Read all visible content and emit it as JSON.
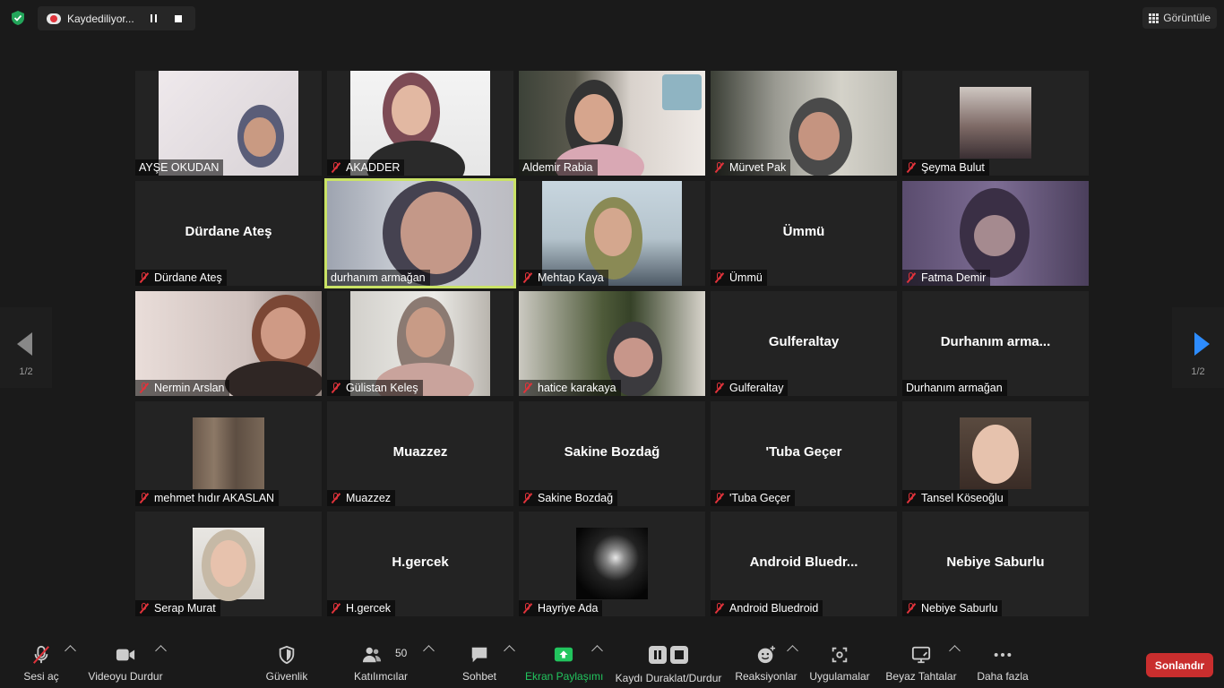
{
  "topbar": {
    "recording_text": "Kaydediliyor...",
    "view_label": "Görüntüle"
  },
  "pager": {
    "left_page": "1/2",
    "right_page": "1/2"
  },
  "tiles": [
    {
      "name": "AYŞE OKUDAN",
      "display": "",
      "muted": false
    },
    {
      "name": "AKADDER",
      "display": "",
      "muted": true
    },
    {
      "name": "Aldemir Rabia",
      "display": "",
      "muted": false
    },
    {
      "name": "Mürvet Pak",
      "display": "",
      "muted": true
    },
    {
      "name": "Şeyma Bulut",
      "display": "",
      "muted": true
    },
    {
      "name": "Dürdane Ateş",
      "display": "Dürdane Ateş",
      "muted": true
    },
    {
      "name": "durhanım armağan",
      "display": "",
      "muted": false
    },
    {
      "name": "Mehtap Kaya",
      "display": "",
      "muted": true
    },
    {
      "name": "Ümmü",
      "display": "Ümmü",
      "muted": true
    },
    {
      "name": "Fatma Demir",
      "display": "",
      "muted": true
    },
    {
      "name": "Nermin Arslan",
      "display": "",
      "muted": true
    },
    {
      "name": "Gülistan Keleş",
      "display": "",
      "muted": true
    },
    {
      "name": "hatice karakaya",
      "display": "",
      "muted": true
    },
    {
      "name": "Gulferaltay",
      "display": "Gulferaltay",
      "muted": true
    },
    {
      "name": "Durhanım armağan",
      "display": "Durhanım  arma...",
      "muted": false
    },
    {
      "name": "mehmet hıdır AKASLAN",
      "display": "",
      "muted": true
    },
    {
      "name": "Muazzez",
      "display": "Muazzez",
      "muted": true
    },
    {
      "name": "Sakine Bozdağ",
      "display": "Sakine Bozdağ",
      "muted": true
    },
    {
      "name": "'Tuba Geçer",
      "display": "'Tuba Geçer",
      "muted": true
    },
    {
      "name": "Tansel Köseoğlu",
      "display": "",
      "muted": true
    },
    {
      "name": "Serap Murat",
      "display": "",
      "muted": true
    },
    {
      "name": "H.gercek",
      "display": "H.gercek",
      "muted": true
    },
    {
      "name": "Hayriye Ada",
      "display": "",
      "muted": true
    },
    {
      "name": "Android Bluedroid",
      "display": "Android  Bluedr...",
      "muted": true
    },
    {
      "name": "Nebiye Saburlu",
      "display": "Nebiye Saburlu",
      "muted": true
    }
  ],
  "toolbar": {
    "unmute": "Sesi aç",
    "stop_video": "Videoyu Durdur",
    "security": "Güvenlik",
    "participants": "Katılımcılar",
    "participants_count": "50",
    "chat": "Sohbet",
    "share_screen": "Ekran Paylaşımı",
    "pause_stop_recording": "Kaydı Duraklat/Durdur",
    "reactions": "Reaksiyonlar",
    "apps": "Uygulamalar",
    "whiteboards": "Beyaz Tahtalar",
    "more": "Daha fazla",
    "end": "Sonlandır"
  },
  "colors": {
    "accent": "#2d8cff",
    "active_speaker": "#c9e265",
    "end": "#c92e2e",
    "share": "#22c55e",
    "muted": "#e0333b"
  }
}
